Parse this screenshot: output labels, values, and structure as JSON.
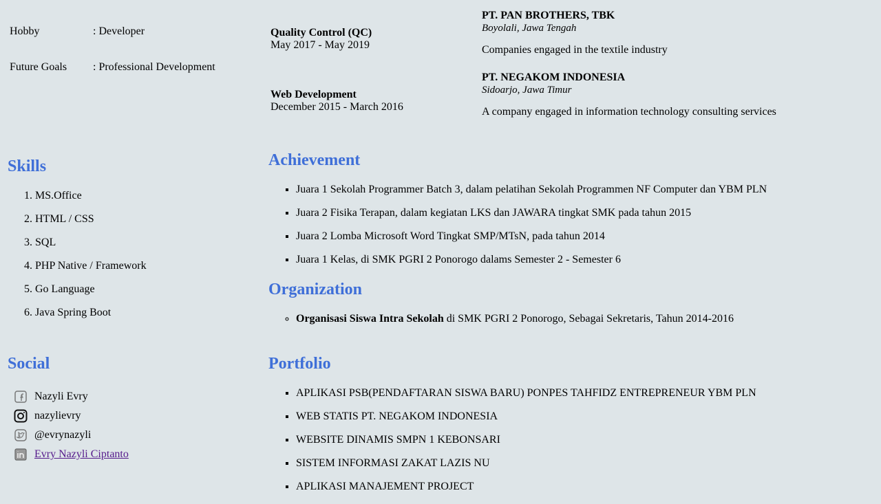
{
  "personal": [
    {
      "label": "Hobby",
      "value": ": Developer"
    },
    {
      "label": "Future Goals",
      "value": ": Professional Development"
    }
  ],
  "jobs": [
    {
      "title": "Quality Control (QC)",
      "period": "May 2017 - May 2019"
    },
    {
      "title": "Web Development",
      "period": "December 2015 - March 2016"
    }
  ],
  "companies": [
    {
      "name": "PT. PAN BROTHERS, TBK",
      "location": "Boyolali, Jawa Tengah",
      "desc": "Companies engaged in the textile industry"
    },
    {
      "name": "PT. NEGAKOM INDONESIA",
      "location": "Sidoarjo, Jawa Timur",
      "desc": "A company engaged in information technology consulting services"
    }
  ],
  "skills": {
    "title": "Skills",
    "items": [
      "MS.Office",
      "HTML / CSS",
      "SQL",
      "PHP Native / Framework",
      "Go Language",
      "Java Spring Boot"
    ]
  },
  "social": {
    "title": "Social",
    "items": [
      {
        "icon": "facebook-icon",
        "label": "Nazyli Evry"
      },
      {
        "icon": "instagram-icon",
        "label": "nazylievry"
      },
      {
        "icon": "twitter-icon",
        "label": "@evrynazyli"
      },
      {
        "icon": "linkedin-icon",
        "label": "Evry Nazyli Ciptanto"
      }
    ]
  },
  "achievement": {
    "title": "Achievement",
    "items": [
      "Juara 1 Sekolah Programmer Batch 3, dalam pelatihan Sekolah Programmen NF Computer dan YBM PLN",
      "Juara 2 Fisika Terapan, dalam kegiatan LKS dan JAWARA tingkat SMK pada tahun 2015",
      "Juara 2 Lomba Microsoft Word Tingkat SMP/MTsN, pada tahun 2014",
      "Juara 1 Kelas, di SMK PGRI 2 Ponorogo dalams Semester 2 - Semester 6"
    ]
  },
  "organization": {
    "title": "Organization",
    "name": "Organisasi Siswa Intra Sekolah",
    "rest": " di SMK PGRI 2 Ponorogo, Sebagai Sekretaris, Tahun 2014-2016"
  },
  "portfolio": {
    "title": "Portfolio",
    "items": [
      "APLIKASI PSB(PENDAFTARAN SISWA BARU) PONPES TAHFIDZ ENTREPRENEUR YBM PLN",
      "WEB STATIS PT. NEGAKOM INDONESIA",
      "WEBSITE DINAMIS SMPN 1 KEBONSARI",
      "SISTEM INFORMASI ZAKAT LAZIS NU",
      "APLIKASI MANAJEMENT PROJECT"
    ]
  }
}
